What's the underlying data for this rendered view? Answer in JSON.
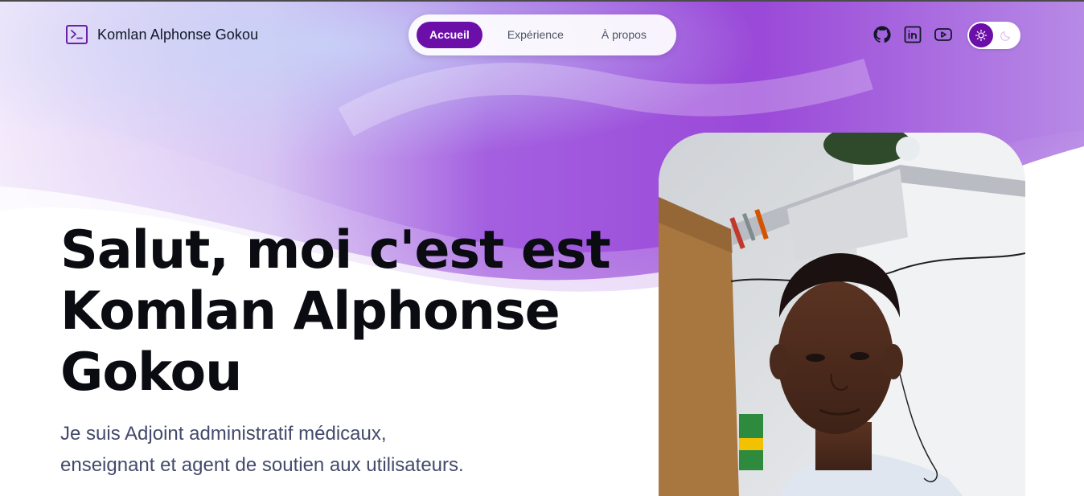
{
  "brand": {
    "name": "Komlan Alphonse Gokou",
    "icon": "terminal-icon"
  },
  "nav": {
    "items": [
      {
        "label": "Accueil",
        "active": true
      },
      {
        "label": "Expérience",
        "active": false
      },
      {
        "label": "À propos",
        "active": false
      }
    ]
  },
  "socials": [
    "github-icon",
    "linkedin-icon",
    "youtube-icon"
  ],
  "theme_toggle": {
    "mode": "light",
    "icons": [
      "sun-icon",
      "moon-icon"
    ]
  },
  "hero": {
    "title_line1": "Salut, moi c'est est",
    "title_line2": "Komlan Alphonse",
    "title_line3": "Gokou",
    "subtitle_line1": "Je suis Adjoint administratif médicaux,",
    "subtitle_line2": "enseignant et agent de soutien aux utilisateurs."
  },
  "colors": {
    "accent": "#6b0fa8",
    "title": "#0b0b12",
    "subtitle": "#434a6b"
  }
}
